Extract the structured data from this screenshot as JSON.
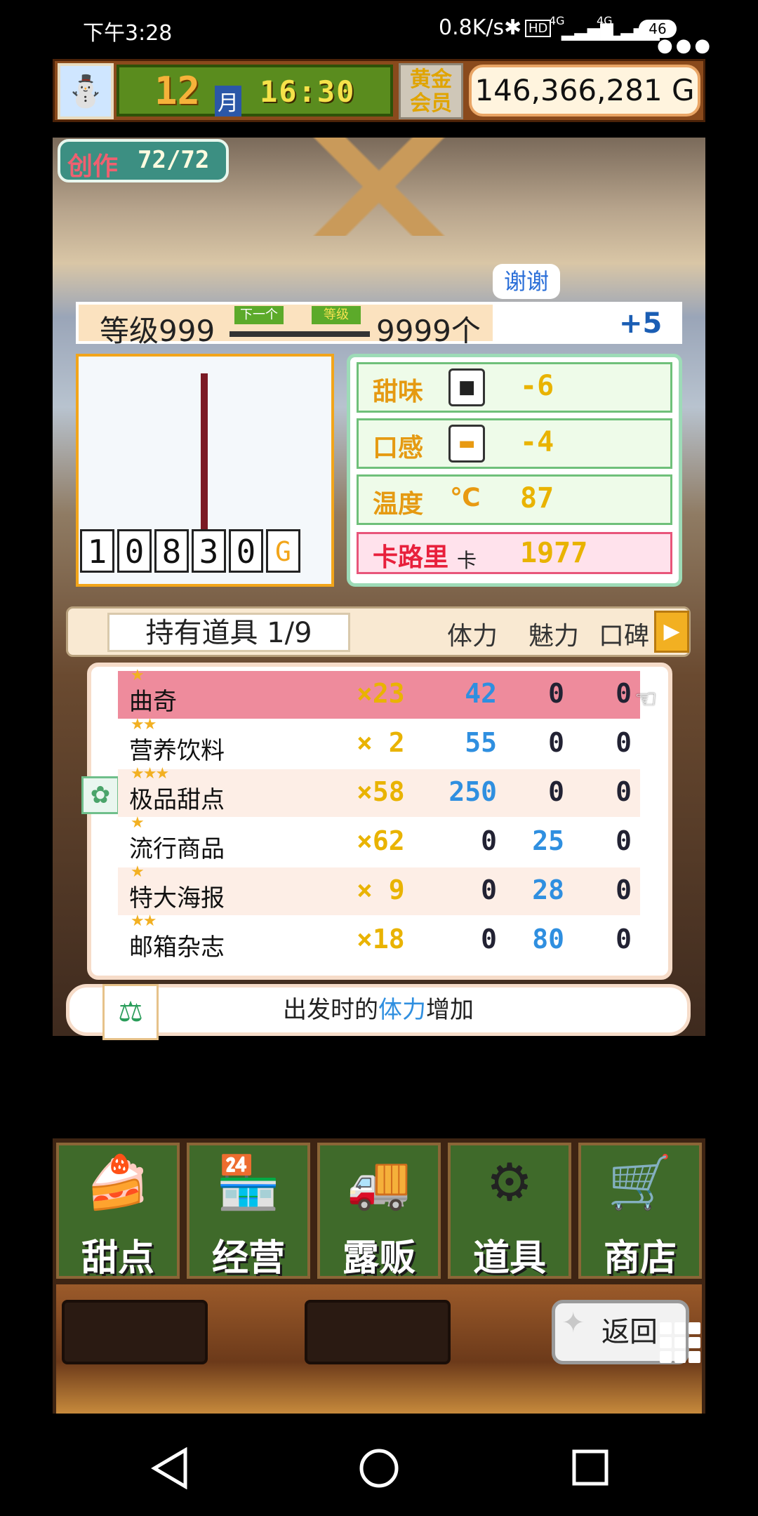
{
  "status_bar": {
    "time": "下午3:28",
    "net_speed": "0.8K/s",
    "hd": "HD",
    "signal1": "4G",
    "signal2": "4G",
    "battery": "46"
  },
  "top_bar": {
    "month_number": "12",
    "month_unit": "月",
    "clock": "16:30",
    "gold_label": "黄金会员",
    "money": "146,366,281 G"
  },
  "create": {
    "label": "创作",
    "value": "72/72"
  },
  "thanks": "谢谢",
  "level": {
    "label": "等级999",
    "next": "下一个",
    "rank": "等级",
    "count": "9999个",
    "bonus": "+5"
  },
  "chart_digits": [
    "1",
    "0",
    "8",
    "3",
    "0",
    "G"
  ],
  "stats": [
    {
      "name": "甜味",
      "icon": "square-icon",
      "value": "-6"
    },
    {
      "name": "口感",
      "icon": "bread-icon",
      "value": "-4"
    },
    {
      "name": "温度",
      "icon": "℃",
      "value": "87"
    },
    {
      "name": "卡路里",
      "unit": "卡",
      "value": "1977"
    }
  ],
  "items_header": {
    "title": "持有道具 1/9",
    "col_stamina": "体力",
    "col_charm": "魅力",
    "col_reputation": "口碑"
  },
  "items": [
    {
      "stars": "★",
      "name": "曲奇",
      "qty": "×23",
      "stamina": "42",
      "charm": "0",
      "rep": "0"
    },
    {
      "stars": "★★",
      "name": "营养饮料",
      "qty": "× 2",
      "stamina": "55",
      "charm": "0",
      "rep": "0"
    },
    {
      "stars": "★★★",
      "name": "极品甜点",
      "qty": "×58",
      "stamina": "250",
      "charm": "0",
      "rep": "0"
    },
    {
      "stars": "★",
      "name": "流行商品",
      "qty": "×62",
      "stamina": "0",
      "charm": "25",
      "rep": "0"
    },
    {
      "stars": "★",
      "name": "特大海报",
      "qty": "× 9",
      "stamina": "0",
      "charm": "28",
      "rep": "0"
    },
    {
      "stars": "★★",
      "name": "邮箱杂志",
      "qty": "×18",
      "stamina": "0",
      "charm": "80",
      "rep": "0"
    }
  ],
  "hint": {
    "prefix": "出发时的",
    "highlight": "体力",
    "suffix": "增加"
  },
  "nav": [
    {
      "label": "甜点",
      "icon": "cake-icon"
    },
    {
      "label": "经营",
      "icon": "shop-icon"
    },
    {
      "label": "露贩",
      "icon": "food-truck-icon"
    },
    {
      "label": "道具",
      "icon": "items-icon"
    },
    {
      "label": "商店",
      "icon": "cart-icon"
    }
  ],
  "back_label": "返回"
}
